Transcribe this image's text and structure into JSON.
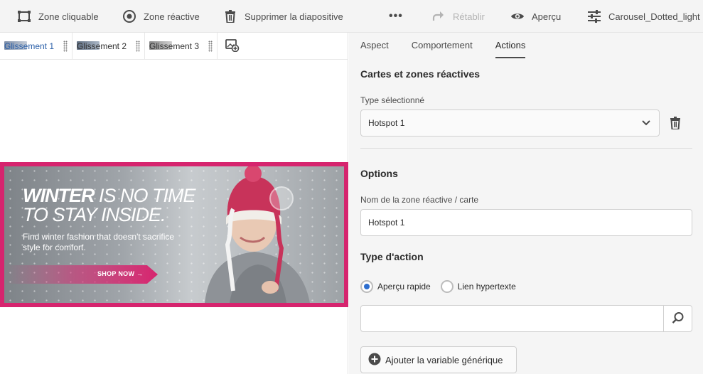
{
  "toolbar": {
    "clickable_zone": "Zone cliquable",
    "hotspot_zone": "Zone réactive",
    "delete_slide": "Supprimer la diapositive",
    "more": "•••",
    "redo": "Rétablir",
    "preview": "Aperçu",
    "preset_name": "Carousel_Dotted_light"
  },
  "slides": [
    {
      "label": "Glissement 1",
      "active": true
    },
    {
      "label": "Glissement 2",
      "active": false
    },
    {
      "label": "Glissement 3",
      "active": false
    }
  ],
  "banner": {
    "headline_bold": "WINTER",
    "headline_rest": " IS NO TIME",
    "headline_line2": "TO STAY INSIDE.",
    "subtext": "Find winter fashion that doesn't sacrifice style for comfort.",
    "cta": "SHOP NOW →",
    "accent_color": "#d6246e"
  },
  "panel": {
    "tabs": [
      "Aspect",
      "Comportement",
      "Actions"
    ],
    "active_tab": "Actions",
    "maps_title": "Cartes et zones réactives",
    "selected_type_label": "Type sélectionné",
    "selected_type_value": "Hotspot 1",
    "options_title": "Options",
    "name_label": "Nom de la zone réactive / carte",
    "name_value": "Hotspot 1",
    "action_type_title": "Type d'action",
    "radio_quickview": "Aperçu rapide",
    "radio_hyperlink": "Lien hypertexte",
    "search_value": "",
    "add_variable": "Ajouter la variable générique"
  }
}
